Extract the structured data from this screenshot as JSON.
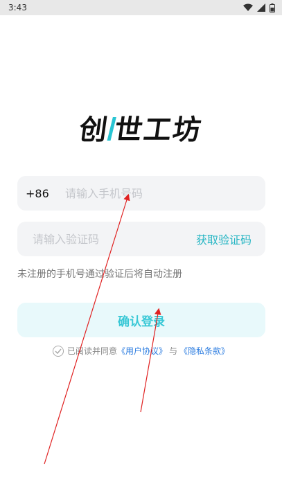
{
  "status_bar": {
    "time": "3:43"
  },
  "brand": {
    "logo_text_left": "创",
    "logo_text_right": "世工坊"
  },
  "login": {
    "country_code": "+86",
    "phone_placeholder": "请输入手机号码",
    "code_placeholder": "请输入验证码",
    "get_code_label": "获取验证码",
    "hint": "未注册的手机号通过验证后将自动注册",
    "login_button": "确认登录"
  },
  "agreement": {
    "prefix": "已阅读并同意",
    "user_agreement": "《用户协议》",
    "and": "与",
    "privacy_policy": "《隐私条款》"
  },
  "colors": {
    "accent": "#29c5d3",
    "link": "#2d7de0",
    "annotation_arrow": "#e02020"
  }
}
